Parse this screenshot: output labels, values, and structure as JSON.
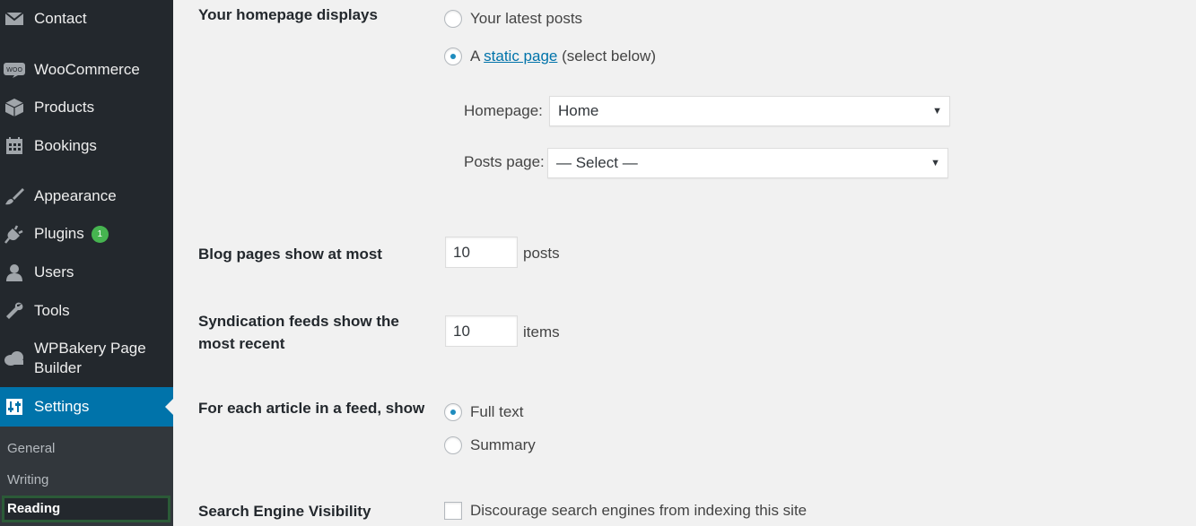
{
  "sidebar": {
    "items": [
      {
        "label": "Contact",
        "icon": "envelope-icon"
      },
      {
        "label": "WooCommerce",
        "icon": "woocommerce-icon"
      },
      {
        "label": "Products",
        "icon": "box-icon"
      },
      {
        "label": "Bookings",
        "icon": "calendar-icon"
      },
      {
        "label": "Appearance",
        "icon": "paintbrush-icon"
      },
      {
        "label": "Plugins",
        "icon": "plugin-icon",
        "badge": "1"
      },
      {
        "label": "Users",
        "icon": "user-icon"
      },
      {
        "label": "Tools",
        "icon": "wrench-icon"
      },
      {
        "label": "WPBakery Page Builder",
        "icon": "cloud-icon"
      },
      {
        "label": "Settings",
        "icon": "settings-icon",
        "current": true
      }
    ],
    "submenu": [
      {
        "label": "General"
      },
      {
        "label": "Writing"
      },
      {
        "label": "Reading",
        "active": true
      }
    ],
    "colors": {
      "background": "#23282d",
      "current": "#0073aa",
      "submenu_bg": "#32373c",
      "badge": "#46b450"
    }
  },
  "reading": {
    "homepage_displays": {
      "label": "Your homepage displays",
      "option_latest": "Your latest posts",
      "option_static_prefix": "A",
      "option_static_link": "static page",
      "option_static_suffix": "(select below)",
      "selected": "static page",
      "homepage_label": "Homepage:",
      "homepage_value": "Home",
      "posts_page_label": "Posts page:",
      "posts_page_value": "— Select —"
    },
    "blog_pages": {
      "label": "Blog pages show at most",
      "value": "10",
      "unit": "posts"
    },
    "syndication": {
      "label_line1": "Syndication feeds show the",
      "label_line2": "most recent",
      "value": "10",
      "unit": "items"
    },
    "feed_article": {
      "label": "For each article in a feed, show",
      "option_full": "Full text",
      "option_summary": "Summary",
      "selected": "Full text"
    },
    "search_visibility": {
      "label": "Search Engine Visibility",
      "checkbox_label": "Discourage search engines from indexing this site",
      "checked": false
    }
  }
}
